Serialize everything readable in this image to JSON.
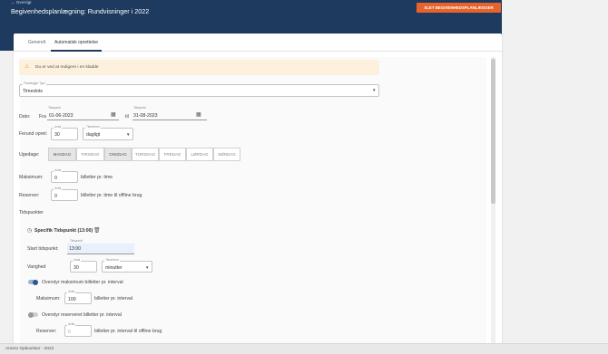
{
  "header": {
    "back_label": "← Oversigt",
    "title": "Begivenhedsplanlægning: Rundvisninger i 2022",
    "delete_button": "SLET BEGIVENHEDSPLANLÆGGER"
  },
  "tabs": [
    {
      "label": "Generelt",
      "active": false
    },
    {
      "label": "Automatisk oprettelse",
      "active": true
    }
  ],
  "warning": {
    "icon": "warning-icon",
    "text": "Du er ved at redigere i en kladde"
  },
  "planner_type": {
    "caption": "Planlægger Type",
    "value": "Timeslots"
  },
  "dates": {
    "label": "Dato:",
    "from_label": "Fra",
    "from_caption": "Tidspunkt",
    "from_value": "01-06-2023",
    "to_label": "til",
    "to_caption": "Tidspunkt",
    "to_value": "31-08-2023"
  },
  "create_every": {
    "label": "Ferund opret:",
    "amount_caption": "Antal",
    "amount": "30",
    "unit_caption": "Tidsenhed",
    "unit": "dagligt"
  },
  "weekdays": {
    "label": "Ugedage:",
    "days": [
      {
        "label": "MANDAG",
        "selected": true
      },
      {
        "label": "TIRSDAG",
        "selected": false
      },
      {
        "label": "ONSDAG",
        "selected": true
      },
      {
        "label": "TORSDAG",
        "selected": false
      },
      {
        "label": "FREDAG",
        "selected": false
      },
      {
        "label": "LØRDAG",
        "selected": false
      },
      {
        "label": "SØNDAG",
        "selected": false
      }
    ]
  },
  "maximum": {
    "label": "Maksimum:",
    "caption": "Antal",
    "value": "0",
    "suffix": "billetter pr. time"
  },
  "reserve": {
    "label": "Reserver:",
    "caption": "Antal",
    "value": "0",
    "suffix": "billetter pr. time til offline brug"
  },
  "timepoints": {
    "section_label": "Tidspunkter",
    "item_title": "Specifik Tidspunkt (13:00)",
    "start_label": "Start tidspunkt:",
    "start_caption": "Tidspunkt",
    "start_value": "13:00",
    "duration_label": "Varighed",
    "duration_caption": "Antal",
    "duration_value": "30",
    "duration_unit_caption": "Tidsenhed",
    "duration_unit": "minutter",
    "override_max_label": "Overstyr maksimum billetter pr. interval",
    "override_max_on": true,
    "inner_max_label": "Maksimum:",
    "inner_max_caption": "Antal",
    "inner_max_value": "100",
    "inner_max_suffix": "billetter pr. interval",
    "override_reserve_label": "Overstyr reserveret billetter pr. interval",
    "override_reserve_on": false,
    "inner_reserve_label": "Reserver:",
    "inner_reserve_caption": "Antal",
    "inner_reserve_value": "0",
    "inner_reserve_suffix": "billetter pr. interval til offline brug"
  },
  "footer": {
    "text": "Amero Oplevelser - 2022"
  },
  "colors": {
    "header": "#1e3a5f",
    "accent": "#e8632b",
    "toggle_on": "#2c5a8f"
  }
}
